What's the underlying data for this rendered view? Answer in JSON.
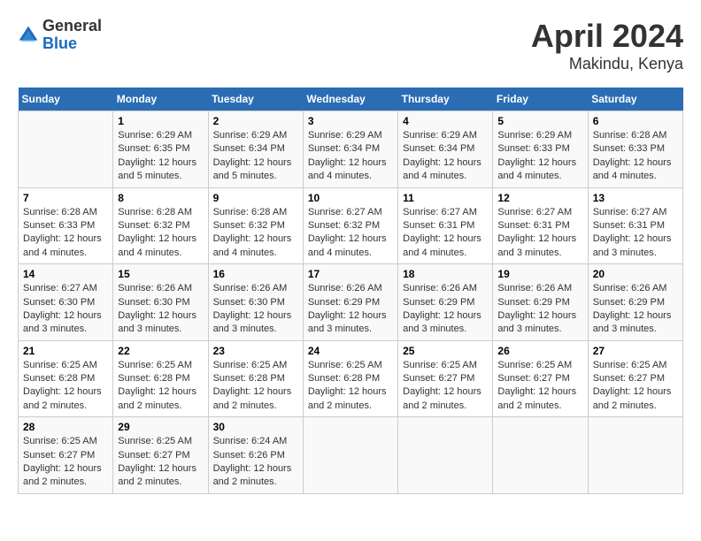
{
  "logo": {
    "general": "General",
    "blue": "Blue"
  },
  "title": "April 2024",
  "subtitle": "Makindu, Kenya",
  "days_of_week": [
    "Sunday",
    "Monday",
    "Tuesday",
    "Wednesday",
    "Thursday",
    "Friday",
    "Saturday"
  ],
  "weeks": [
    [
      {
        "num": "",
        "info": ""
      },
      {
        "num": "1",
        "info": "Sunrise: 6:29 AM\nSunset: 6:35 PM\nDaylight: 12 hours\nand 5 minutes."
      },
      {
        "num": "2",
        "info": "Sunrise: 6:29 AM\nSunset: 6:34 PM\nDaylight: 12 hours\nand 5 minutes."
      },
      {
        "num": "3",
        "info": "Sunrise: 6:29 AM\nSunset: 6:34 PM\nDaylight: 12 hours\nand 4 minutes."
      },
      {
        "num": "4",
        "info": "Sunrise: 6:29 AM\nSunset: 6:34 PM\nDaylight: 12 hours\nand 4 minutes."
      },
      {
        "num": "5",
        "info": "Sunrise: 6:29 AM\nSunset: 6:33 PM\nDaylight: 12 hours\nand 4 minutes."
      },
      {
        "num": "6",
        "info": "Sunrise: 6:28 AM\nSunset: 6:33 PM\nDaylight: 12 hours\nand 4 minutes."
      }
    ],
    [
      {
        "num": "7",
        "info": "Sunrise: 6:28 AM\nSunset: 6:33 PM\nDaylight: 12 hours\nand 4 minutes."
      },
      {
        "num": "8",
        "info": "Sunrise: 6:28 AM\nSunset: 6:32 PM\nDaylight: 12 hours\nand 4 minutes."
      },
      {
        "num": "9",
        "info": "Sunrise: 6:28 AM\nSunset: 6:32 PM\nDaylight: 12 hours\nand 4 minutes."
      },
      {
        "num": "10",
        "info": "Sunrise: 6:27 AM\nSunset: 6:32 PM\nDaylight: 12 hours\nand 4 minutes."
      },
      {
        "num": "11",
        "info": "Sunrise: 6:27 AM\nSunset: 6:31 PM\nDaylight: 12 hours\nand 4 minutes."
      },
      {
        "num": "12",
        "info": "Sunrise: 6:27 AM\nSunset: 6:31 PM\nDaylight: 12 hours\nand 3 minutes."
      },
      {
        "num": "13",
        "info": "Sunrise: 6:27 AM\nSunset: 6:31 PM\nDaylight: 12 hours\nand 3 minutes."
      }
    ],
    [
      {
        "num": "14",
        "info": "Sunrise: 6:27 AM\nSunset: 6:30 PM\nDaylight: 12 hours\nand 3 minutes."
      },
      {
        "num": "15",
        "info": "Sunrise: 6:26 AM\nSunset: 6:30 PM\nDaylight: 12 hours\nand 3 minutes."
      },
      {
        "num": "16",
        "info": "Sunrise: 6:26 AM\nSunset: 6:30 PM\nDaylight: 12 hours\nand 3 minutes."
      },
      {
        "num": "17",
        "info": "Sunrise: 6:26 AM\nSunset: 6:29 PM\nDaylight: 12 hours\nand 3 minutes."
      },
      {
        "num": "18",
        "info": "Sunrise: 6:26 AM\nSunset: 6:29 PM\nDaylight: 12 hours\nand 3 minutes."
      },
      {
        "num": "19",
        "info": "Sunrise: 6:26 AM\nSunset: 6:29 PM\nDaylight: 12 hours\nand 3 minutes."
      },
      {
        "num": "20",
        "info": "Sunrise: 6:26 AM\nSunset: 6:29 PM\nDaylight: 12 hours\nand 3 minutes."
      }
    ],
    [
      {
        "num": "21",
        "info": "Sunrise: 6:25 AM\nSunset: 6:28 PM\nDaylight: 12 hours\nand 2 minutes."
      },
      {
        "num": "22",
        "info": "Sunrise: 6:25 AM\nSunset: 6:28 PM\nDaylight: 12 hours\nand 2 minutes."
      },
      {
        "num": "23",
        "info": "Sunrise: 6:25 AM\nSunset: 6:28 PM\nDaylight: 12 hours\nand 2 minutes."
      },
      {
        "num": "24",
        "info": "Sunrise: 6:25 AM\nSunset: 6:28 PM\nDaylight: 12 hours\nand 2 minutes."
      },
      {
        "num": "25",
        "info": "Sunrise: 6:25 AM\nSunset: 6:27 PM\nDaylight: 12 hours\nand 2 minutes."
      },
      {
        "num": "26",
        "info": "Sunrise: 6:25 AM\nSunset: 6:27 PM\nDaylight: 12 hours\nand 2 minutes."
      },
      {
        "num": "27",
        "info": "Sunrise: 6:25 AM\nSunset: 6:27 PM\nDaylight: 12 hours\nand 2 minutes."
      }
    ],
    [
      {
        "num": "28",
        "info": "Sunrise: 6:25 AM\nSunset: 6:27 PM\nDaylight: 12 hours\nand 2 minutes."
      },
      {
        "num": "29",
        "info": "Sunrise: 6:25 AM\nSunset: 6:27 PM\nDaylight: 12 hours\nand 2 minutes."
      },
      {
        "num": "30",
        "info": "Sunrise: 6:24 AM\nSunset: 6:26 PM\nDaylight: 12 hours\nand 2 minutes."
      },
      {
        "num": "",
        "info": ""
      },
      {
        "num": "",
        "info": ""
      },
      {
        "num": "",
        "info": ""
      },
      {
        "num": "",
        "info": ""
      }
    ]
  ]
}
